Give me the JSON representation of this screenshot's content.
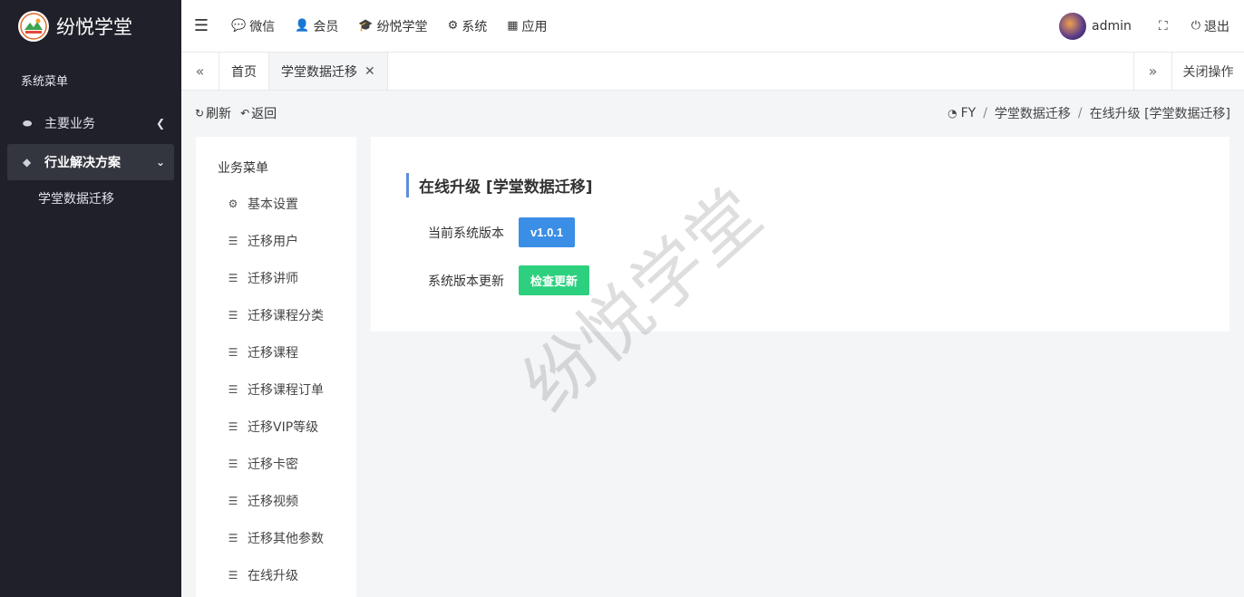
{
  "brand": {
    "name": "纷悦学堂"
  },
  "sidebar": {
    "title": "系统菜单",
    "items": [
      {
        "label": "主要业务",
        "icon": "leaf-icon",
        "expanded": false
      },
      {
        "label": "行业解决方案",
        "icon": "diamond-icon",
        "expanded": true,
        "children": [
          {
            "label": "学堂数据迁移"
          }
        ]
      }
    ]
  },
  "topbar": {
    "menu": [
      {
        "label": "微信",
        "icon": "comments-icon"
      },
      {
        "label": "会员",
        "icon": "user-icon"
      },
      {
        "label": "纷悦学堂",
        "icon": "graduation-cap-icon"
      },
      {
        "label": "系统",
        "icon": "cogs-icon"
      },
      {
        "label": "应用",
        "icon": "grid-icon"
      }
    ],
    "user": "admin",
    "logout": "退出"
  },
  "tabs": {
    "items": [
      {
        "label": "首页",
        "active": false
      },
      {
        "label": "学堂数据迁移",
        "active": true
      }
    ],
    "close_ops": "关闭操作"
  },
  "actions": {
    "refresh": "刷新",
    "back": "返回"
  },
  "breadcrumb": [
    "FY",
    "学堂数据迁移",
    "在线升级 [学堂数据迁移]"
  ],
  "bizmenu": {
    "title": "业务菜单",
    "items": [
      {
        "label": "基本设置",
        "icon": "gear-icon"
      },
      {
        "label": "迁移用户",
        "icon": "list-icon"
      },
      {
        "label": "迁移讲师",
        "icon": "list-icon"
      },
      {
        "label": "迁移课程分类",
        "icon": "list-icon"
      },
      {
        "label": "迁移课程",
        "icon": "list-icon"
      },
      {
        "label": "迁移课程订单",
        "icon": "list-icon"
      },
      {
        "label": "迁移VIP等级",
        "icon": "list-icon"
      },
      {
        "label": "迁移卡密",
        "icon": "list-icon"
      },
      {
        "label": "迁移视频",
        "icon": "list-icon"
      },
      {
        "label": "迁移其他参数",
        "icon": "list-icon"
      },
      {
        "label": "在线升级",
        "icon": "list-icon"
      }
    ]
  },
  "panel": {
    "title": "在线升级 [学堂数据迁移]",
    "current_version_label": "当前系统版本",
    "current_version": "v1.0.1",
    "update_label": "系统版本更新",
    "check_button": "检查更新"
  },
  "watermark": "纷悦学堂",
  "colors": {
    "sidebar_bg": "#1f2029",
    "primary": "#3a8ee6",
    "success": "#2dd07e",
    "accent_bar": "#5b8fd6"
  }
}
